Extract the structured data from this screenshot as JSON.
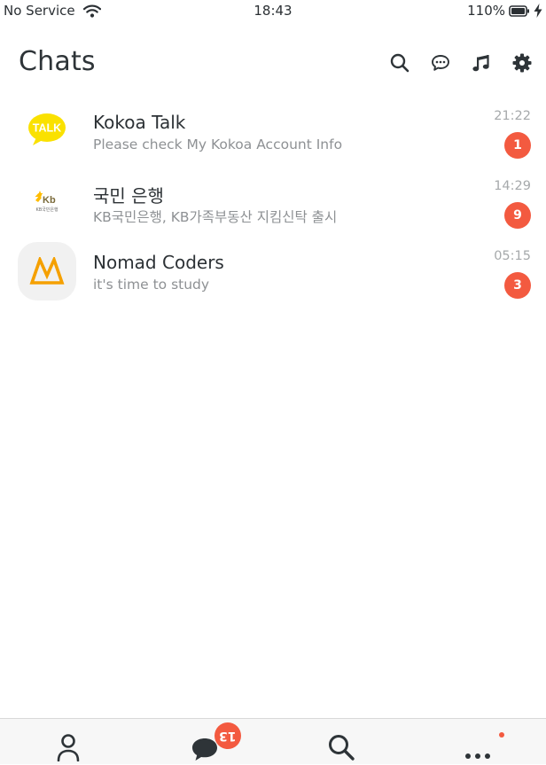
{
  "status_bar": {
    "carrier": "No Service",
    "time": "18:43",
    "battery": "110%",
    "icons": [
      "wifi-icon",
      "battery-icon",
      "charging-icon"
    ]
  },
  "header": {
    "title": "Chats",
    "actions": [
      "search-icon",
      "new-chat-icon",
      "music-icon",
      "settings-icon"
    ]
  },
  "chats": [
    {
      "name": "Kokoa Talk",
      "preview": "Please check My Kokoa Account Info",
      "time": "21:22",
      "unread": "1",
      "avatar_text": "TALK",
      "avatar_color": "#fae100"
    },
    {
      "name": "국민 은행",
      "preview": "KB국민은행, KB가족부동산 지킴신탁 출시",
      "time": "14:29",
      "unread": "9",
      "avatar_text": "KB국민은행",
      "avatar_color": "#ffbc00"
    },
    {
      "name": "Nomad Coders",
      "preview": "it's time to study",
      "time": "05:15",
      "unread": "3",
      "avatar_color": "#f5a000"
    }
  ],
  "tab_bar": {
    "tabs": [
      "friends-tab",
      "chats-tab",
      "search-tab",
      "more-tab"
    ],
    "chats_badge": "13"
  },
  "colors": {
    "badge": "#f35a40",
    "text_primary": "#2c3135",
    "text_secondary": "#8e9194",
    "text_time": "#a6a9ab",
    "tab_bar_bg": "#f7f7f7"
  }
}
